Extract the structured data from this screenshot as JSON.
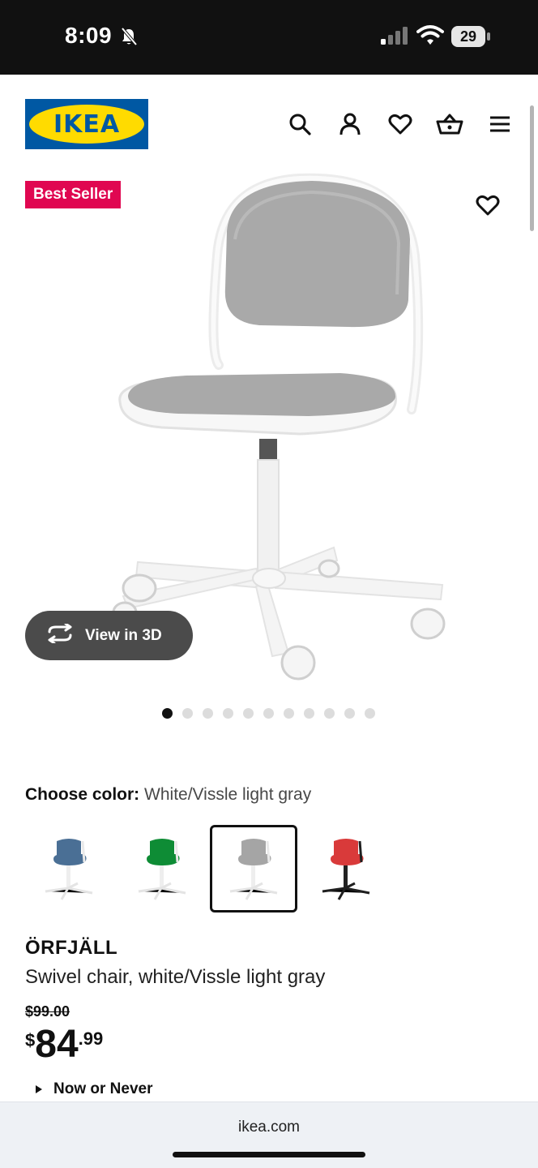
{
  "status_bar": {
    "time": "8:09",
    "battery": "29",
    "icons": [
      "bell-muted-icon",
      "signal-icon",
      "wifi-icon",
      "battery-icon"
    ]
  },
  "header": {
    "logo_text": "IKEA",
    "icons": [
      "search-icon",
      "account-icon",
      "favorites-icon",
      "basket-icon",
      "menu-icon"
    ]
  },
  "media": {
    "badge": "Best Seller",
    "view_3d_label": "View in 3D",
    "image_count": 11,
    "active_image": 1
  },
  "color_chooser": {
    "label": "Choose color:",
    "value": "White/Vissle light gray",
    "options": [
      {
        "name": "blue",
        "seat_color": "#4a6f95",
        "frame_color": "#ffffff"
      },
      {
        "name": "green",
        "seat_color": "#0e8c35",
        "frame_color": "#ffffff"
      },
      {
        "name": "light-gray",
        "seat_color": "#a5a5a5",
        "frame_color": "#ffffff",
        "selected": true
      },
      {
        "name": "red",
        "seat_color": "#d93a3a",
        "frame_color": "#1f1f1f"
      }
    ]
  },
  "product": {
    "name": "ÖRFJÄLL",
    "description": "Swivel chair, white/Vissle light gray",
    "old_price": "$99.00",
    "price_currency": "$",
    "price_integer": "84",
    "price_decimal": ".99",
    "promo_label": "Now or Never"
  },
  "browser": {
    "url": "ikea.com"
  },
  "colors": {
    "ikea_blue": "#0058a3",
    "ikea_yellow": "#ffdb00",
    "badge_red": "#e00751"
  }
}
